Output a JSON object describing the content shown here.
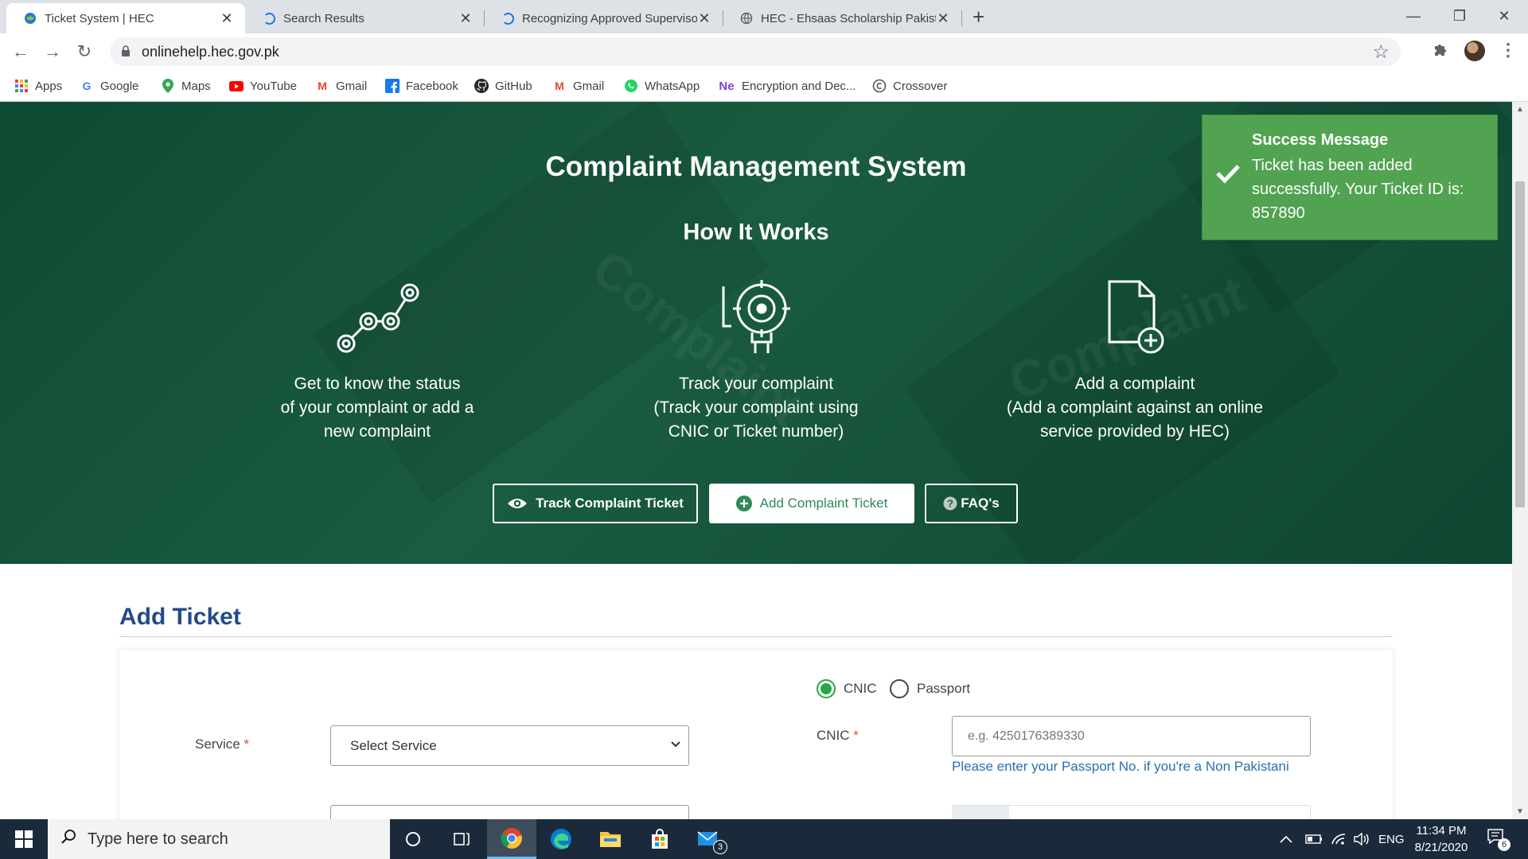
{
  "browser": {
    "tabs": [
      {
        "title": "Ticket System | HEC",
        "active": true,
        "favicon": "hec-globe-icon"
      },
      {
        "title": "Search Results",
        "active": false,
        "favicon": "loading-spinner-icon"
      },
      {
        "title": "Recognizing Approved Superviso",
        "active": false,
        "favicon": "loading-spinner-icon"
      },
      {
        "title": "HEC - Ehsaas Scholarship Pakista",
        "active": false,
        "favicon": "globe-icon"
      }
    ],
    "url": "onlinehelp.hec.gov.pk",
    "bookmarks": [
      {
        "label": "Apps",
        "icon": "apps-grid-icon"
      },
      {
        "label": "Google",
        "icon": "google-icon"
      },
      {
        "label": "Maps",
        "icon": "maps-pin-icon"
      },
      {
        "label": "YouTube",
        "icon": "youtube-icon"
      },
      {
        "label": "Gmail",
        "icon": "gmail-icon"
      },
      {
        "label": "Facebook",
        "icon": "facebook-icon"
      },
      {
        "label": "GitHub",
        "icon": "github-icon"
      },
      {
        "label": "Gmail",
        "icon": "gmail-icon"
      },
      {
        "label": "WhatsApp",
        "icon": "whatsapp-icon"
      },
      {
        "label": "Encryption and Dec...",
        "icon": "ne-icon"
      },
      {
        "label": "Crossover",
        "icon": "crossover-icon"
      }
    ]
  },
  "hero": {
    "title": "Complaint Management System",
    "subtitle": "How It Works",
    "watermarks": [
      "Complaint",
      "Complaint"
    ],
    "features": [
      {
        "line1": "Get to know the status",
        "line2": "of your complaint or add a",
        "line3": "new complaint",
        "icon": "status-steps-icon"
      },
      {
        "line1": "Track your complaint",
        "line2": "(Track your complaint using",
        "line3": "CNIC or Ticket number)",
        "icon": "target-tracking-icon"
      },
      {
        "line1": "Add a complaint",
        "line2": "(Add a complaint against an online",
        "line3": "service provided by HEC)",
        "icon": "add-document-icon"
      }
    ],
    "buttons": {
      "track": "Track Complaint Ticket",
      "add": "Add Complaint Ticket",
      "faq": "FAQ's"
    }
  },
  "toast": {
    "title": "Success Message",
    "message": "Ticket has been added successfully. Your Ticket ID is: 857890",
    "color": "#51a351"
  },
  "form": {
    "heading": "Add Ticket",
    "id_type": {
      "options": [
        "CNIC",
        "Passport"
      ],
      "selected": "CNIC"
    },
    "service_label": "Service",
    "service_value": "Select Service",
    "cnic_label": "CNIC",
    "cnic_placeholder": "e.g. 4250176389330",
    "cnic_help": "Please enter your Passport No. if you're a Non Pakistani",
    "required_mark": "*"
  },
  "taskbar": {
    "search_placeholder": "Type here to search",
    "mail_badge": "3",
    "language": "ENG",
    "time": "11:34 PM",
    "date": "8/21/2020",
    "notifications": "6"
  },
  "colors": {
    "hero_green": "#165a3e",
    "heading_blue": "#244a8a",
    "link_blue": "#2a6fb0",
    "accent_green": "#28a745"
  }
}
